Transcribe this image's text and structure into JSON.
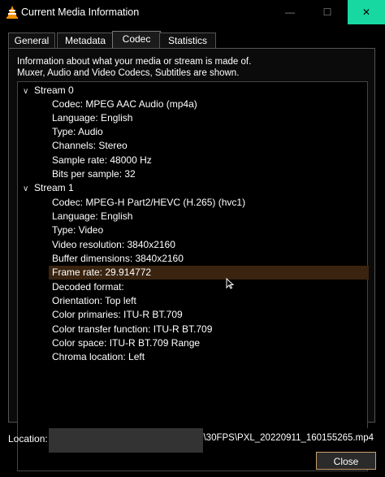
{
  "window": {
    "title": "Current Media Information",
    "minimize_glyph": "—",
    "maximize_glyph": "☐",
    "close_glyph": "✕",
    "accent_close": "#16d8a0",
    "app_icon": "vlc-cone-icon"
  },
  "tabs": [
    {
      "label": "General",
      "active": false
    },
    {
      "label": "Metadata",
      "active": false
    },
    {
      "label": "Codec",
      "active": true
    },
    {
      "label": "Statistics",
      "active": false
    }
  ],
  "info_text": {
    "line1": "Information about what your media or stream is made of.",
    "line2": "Muxer, Audio and Video Codecs, Subtitles are shown."
  },
  "streams": [
    {
      "label": "Stream 0",
      "expanded": true,
      "properties": [
        "Codec: MPEG AAC Audio (mp4a)",
        "Language: English",
        "Type: Audio",
        "Channels: Stereo",
        "Sample rate: 48000 Hz",
        "Bits per sample: 32"
      ]
    },
    {
      "label": "Stream 1",
      "expanded": true,
      "properties": [
        "Codec: MPEG-H Part2/HEVC (H.265) (hvc1)",
        "Language: English",
        "Type: Video",
        "Video resolution: 3840x2160",
        "Buffer dimensions: 3840x2160",
        "Frame rate: 29.914772",
        "Decoded format:",
        "Orientation: Top left",
        "Color primaries: ITU-R BT.709",
        "Color transfer function: ITU-R BT.709",
        "Color space: ITU-R BT.709 Range",
        "Chroma location: Left"
      ]
    }
  ],
  "selected_property": "Frame rate: 29.914772",
  "selection_color": "#3a2410",
  "location": {
    "label": "Location:",
    "value": "ds\\30FPS\\PXL_20220911_160155265.mp4"
  },
  "close_button": {
    "label": "Close"
  }
}
